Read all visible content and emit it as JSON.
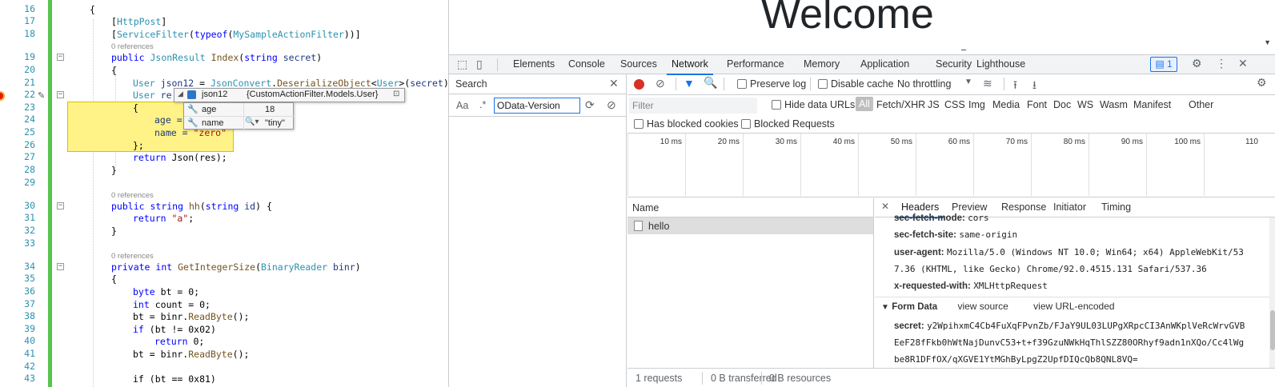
{
  "editor": {
    "lines": [
      "16",
      "17",
      "18",
      "19",
      "20",
      "21",
      "22",
      "23",
      "24",
      "25",
      "26",
      "27",
      "28",
      "29",
      "30",
      "31",
      "32",
      "33",
      "34",
      "35",
      "36",
      "37",
      "38",
      "39",
      "40",
      "41",
      "42",
      "43"
    ],
    "references": "0 references",
    "code": {
      "l16": "{",
      "l17_attr": "HttpPost",
      "l18_attr": "ServiceFilter",
      "l18_typeof": "typeof",
      "l18_type": "MySampleActionFilter",
      "l19_kw": "public",
      "l19_type": "JsonResult",
      "l19_name": "Index",
      "l19_param_kw": "string",
      "l19_param": "secret",
      "l20": "{",
      "l21_type": "User",
      "l21_var": "json12",
      "l21_class": "JsonConvert",
      "l21_method": "DeserializeObject",
      "l21_gen": "User",
      "l21_arg": "secret",
      "l22_type": "User",
      "l22_var": "re",
      "l23": "{",
      "l24_field": "age =",
      "l25_field": "name =",
      "l25_val": "\"zero\"",
      "l26": "};",
      "l27_kw": "return",
      "l27_rest": "Json(res);",
      "l28": "}",
      "l30_kw1": "public",
      "l30_kw2": "string",
      "l30_name": "hh",
      "l30_pkw": "string",
      "l30_param": "id",
      "l31_kw": "return",
      "l31_str": "\"a\"",
      "l32": "}",
      "l34_kw1": "private",
      "l34_kw2": "int",
      "l34_name": "GetIntegerSize",
      "l34_ptype": "BinaryReader",
      "l34_param": "binr",
      "l35": "{",
      "l36_kw": "byte",
      "l36_rest": "bt = 0;",
      "l37_kw": "int",
      "l37_rest": "count = 0;",
      "l38_pre": "bt = binr.",
      "l38_method": "ReadByte",
      "l38_post": "();",
      "l39_kw": "if",
      "l39_rest": "(bt != 0x02)",
      "l40_kw": "return",
      "l40_rest": "0;",
      "l41_pre": "bt = binr.",
      "l41_method": "ReadByte",
      "l41_post": "();",
      "l43": "if (bt == 0x81)"
    },
    "tooltip": {
      "name": "json12",
      "type": "{CustomActionFilter.Models.User}",
      "fields": [
        {
          "name": "age",
          "value": "18"
        },
        {
          "name": "name",
          "value": "\"tiny\""
        }
      ]
    }
  },
  "page": {
    "heading": "Welcome"
  },
  "devtools": {
    "tabs": [
      "Elements",
      "Console",
      "Sources",
      "Network",
      "Performance",
      "Memory",
      "Application",
      "Security",
      "Lighthouse"
    ],
    "active_tab": "Network",
    "issues_count": "1",
    "search": {
      "title": "Search",
      "case_label": "Aa",
      "regex_label": ".*",
      "query": "OData-Version"
    },
    "network": {
      "preserve_log": "Preserve log",
      "disable_cache": "Disable cache",
      "throttling": "No throttling",
      "filter_placeholder": "Filter",
      "hide_data_urls": "Hide data URLs",
      "types": [
        "All",
        "Fetch/XHR",
        "JS",
        "CSS",
        "Img",
        "Media",
        "Font",
        "Doc",
        "WS",
        "Wasm",
        "Manifest",
        "Other"
      ],
      "has_blocked_cookies": "Has blocked cookies",
      "blocked_requests": "Blocked Requests",
      "ticks": [
        "10 ms",
        "20 ms",
        "30 ms",
        "40 ms",
        "50 ms",
        "60 ms",
        "70 ms",
        "80 ms",
        "90 ms",
        "100 ms",
        "110"
      ],
      "name_header": "Name",
      "requests": [
        {
          "name": "hello"
        }
      ],
      "status": {
        "requests": "1 requests",
        "transferred": "0 B transferred",
        "resources": "0 B resources"
      }
    },
    "details": {
      "tabs": [
        "Headers",
        "Preview",
        "Response",
        "Initiator",
        "Timing"
      ],
      "active": "Headers",
      "headers": [
        {
          "k": "sec-fetch-mode:",
          "v": "cors"
        },
        {
          "k": "sec-fetch-site:",
          "v": "same-origin"
        },
        {
          "k": "user-agent:",
          "v": "Mozilla/5.0 (Windows NT 10.0; Win64; x64) AppleWebKit/53"
        },
        {
          "k": "",
          "v": "7.36 (KHTML, like Gecko) Chrome/92.0.4515.131 Safari/537.36"
        },
        {
          "k": "x-requested-with:",
          "v": "XMLHttpRequest"
        }
      ],
      "form_data": {
        "title": "Form Data",
        "view_source": "view source",
        "view_url": "view URL-encoded",
        "key": "secret:",
        "value_lines": [
          "y2WpihxmC4Cb4FuXqFPvnZb/FJaY9UL03LUPgXRpcCI3AnWKplVeRcWrvGVB",
          "EeF28fFkb0hWtNajDunvC53+t+f39GzuNWkHqThlSZZ80ORhyf9adn1nXQo/Cc4lWg",
          "be8R1DFfOX/qXGVE1YtMGhByLpgZ2UpfDIQcQb8QNL8VQ="
        ]
      }
    }
  }
}
